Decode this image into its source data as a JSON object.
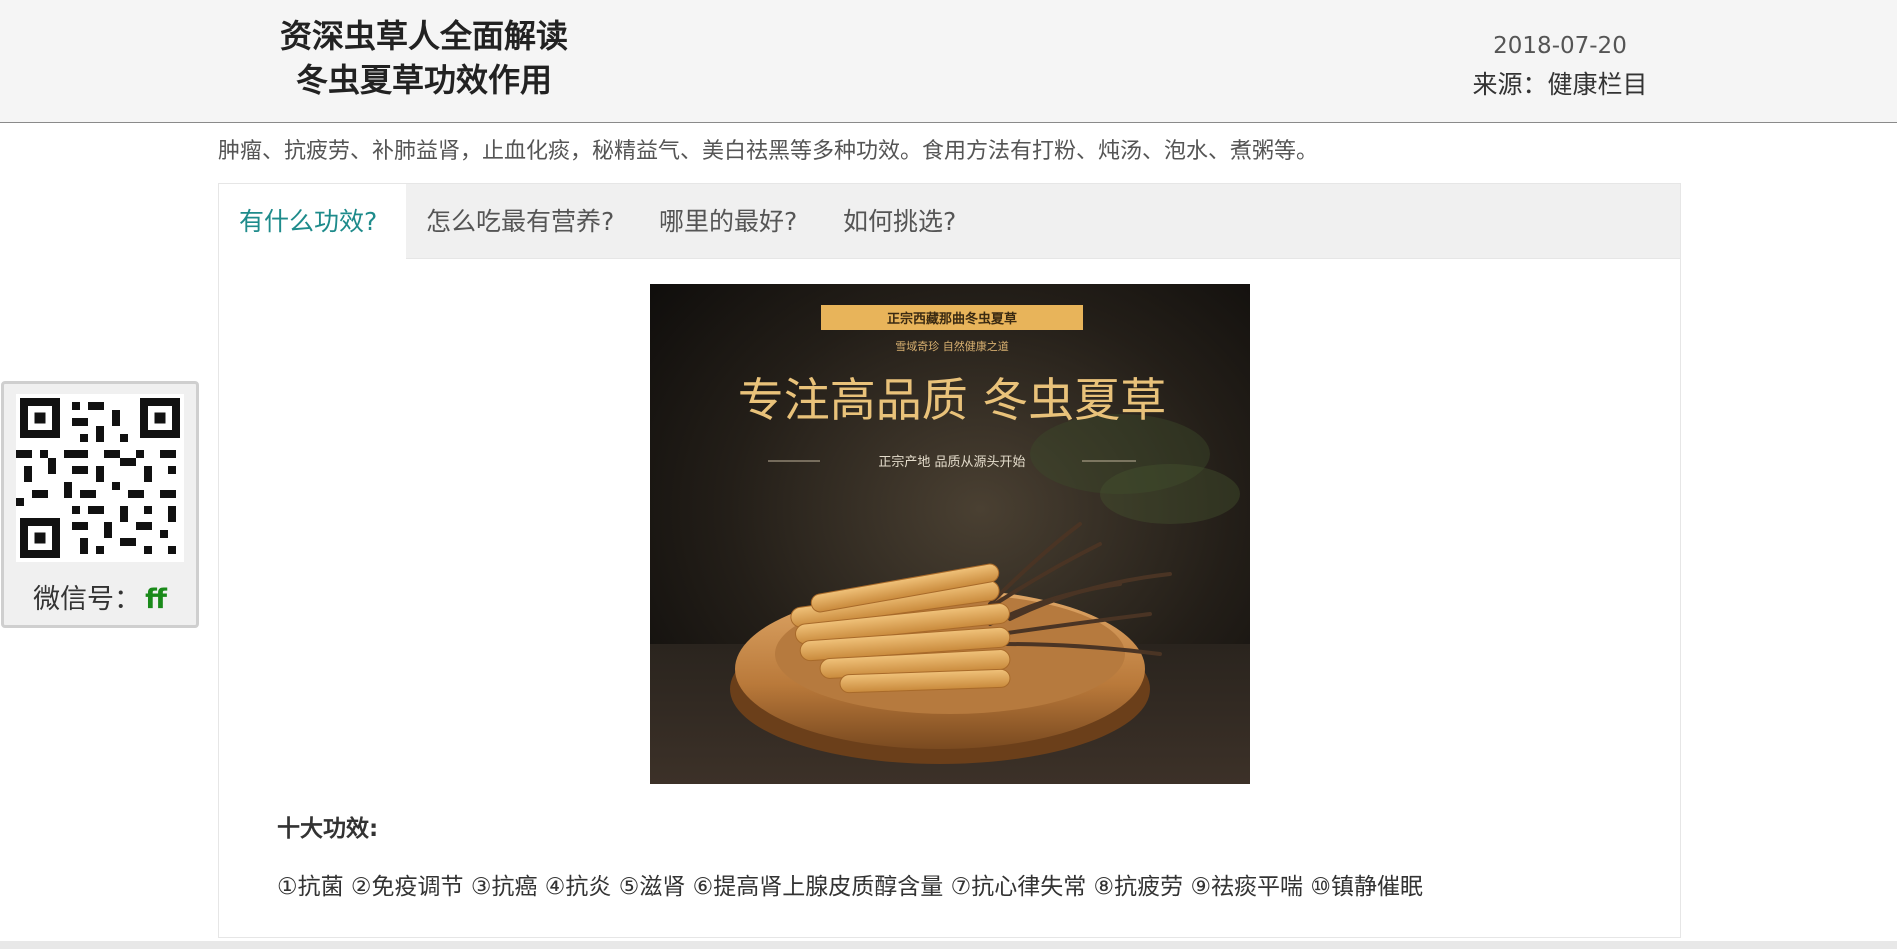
{
  "header": {
    "title_line1": "资深虫草人全面解读",
    "title_line2": "冬虫夏草功效作用",
    "date": "2018-07-20",
    "source": "来源：健康栏目"
  },
  "intro_text": "肿瘤、抗疲劳、补肺益肾，止血化痰，秘精益气、美白祛黑等多种功效。食用方法有打粉、炖汤、泡水、煮粥等。",
  "tabs": [
    {
      "label": "有什么功效?",
      "active": true
    },
    {
      "label": "怎么吃最有营养?",
      "active": false
    },
    {
      "label": "哪里的最好?",
      "active": false
    },
    {
      "label": "如何挑选?",
      "active": false
    }
  ],
  "product_image": {
    "banner": "正宗西藏那曲冬虫夏草",
    "subtitle": "雪域奇珍 自然健康之道",
    "headline": "专注高品质 冬虫夏草",
    "tagline": "正宗产地 品质从源头开始"
  },
  "content": {
    "section_heading": "十大功效:",
    "benefits": "①抗菌 ②免疫调节 ③抗癌 ④抗炎 ⑤滋肾 ⑥提高肾上腺皮质醇含量 ⑦抗心律失常 ⑧抗疲劳 ⑨祛痰平喘 ⑩镇静催眠"
  },
  "qr_widget": {
    "label": "微信号：",
    "wechat_id": "ff"
  },
  "colors": {
    "accent_tab": "#1e8b8b",
    "wechat_id": "#1a8a1a",
    "header_bg": "#f5f5f5"
  }
}
